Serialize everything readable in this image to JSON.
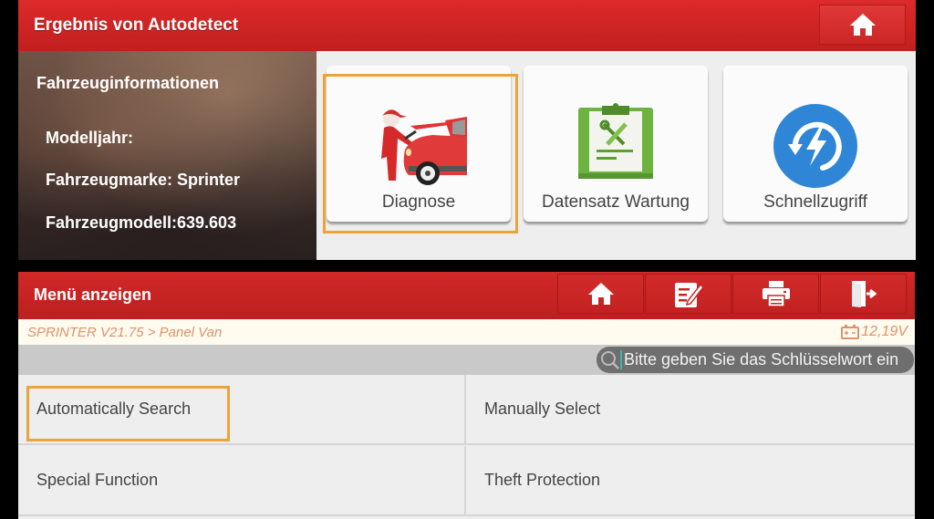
{
  "top_screen": {
    "header": {
      "title": "Ergebnis von Autodetect",
      "home_icon": "home-icon"
    },
    "vehicle_info": {
      "heading": "Fahrzeuginformationen",
      "model_year": "Modelljahr:",
      "brand": "Fahrzeugmarke: Sprinter",
      "model": "Fahrzeugmodell:639.603"
    },
    "tiles": [
      {
        "label": "Diagnose",
        "icon": "mechanic-car-icon",
        "highlighted": true
      },
      {
        "label": "Datensatz Wartung",
        "icon": "clipboard-tools-icon",
        "highlighted": false
      },
      {
        "label": "Schnellzugriff",
        "icon": "quick-access-bolt-icon",
        "highlighted": false
      }
    ]
  },
  "bottom_screen": {
    "header": {
      "title": "Menü anzeigen",
      "buttons": [
        {
          "icon": "home-icon"
        },
        {
          "icon": "edit-report-icon"
        },
        {
          "icon": "printer-icon"
        },
        {
          "icon": "exit-door-icon"
        }
      ]
    },
    "breadcrumb": "SPRINTER V21.75 > Panel Van",
    "battery": {
      "icon": "battery-icon",
      "voltage": "12,19V"
    },
    "search": {
      "placeholder": "Bitte geben Sie das Schlüsselwort ein",
      "value": ""
    },
    "menu_items": [
      {
        "label": "Automatically Search",
        "highlighted": true
      },
      {
        "label": "Manually Select",
        "highlighted": false
      },
      {
        "label": "Special Function",
        "highlighted": false
      },
      {
        "label": "Theft Protection",
        "highlighted": false
      }
    ]
  },
  "colors": {
    "header_red": "#d22828",
    "highlight_orange": "#e9a43a",
    "breadcrumb_text": "#e0916c",
    "breadcrumb_bg": "#fffbee"
  }
}
